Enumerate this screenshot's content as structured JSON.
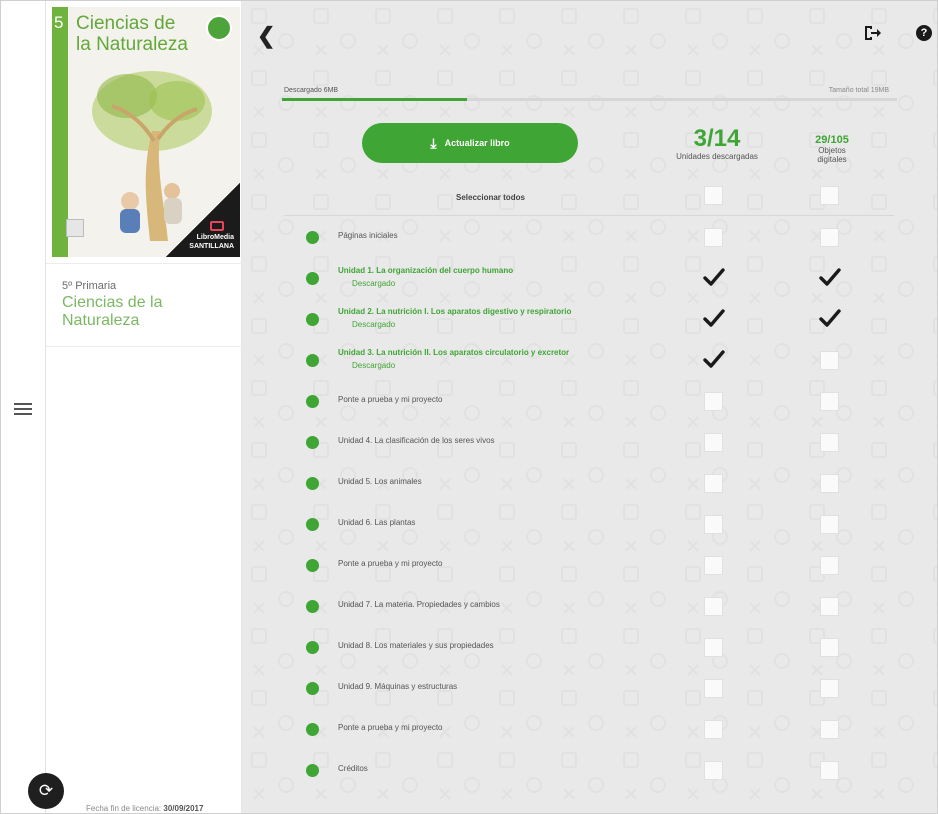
{
  "app": {
    "back_icon": "chevron-left-icon",
    "logout_icon": "logout-icon",
    "help_icon": "help-icon",
    "help_glyph": "?",
    "menu_icon": "hamburger-icon",
    "sync_icon": "sync-icon"
  },
  "book": {
    "cover_grade": "5",
    "cover_title_line1": "Ciencias de",
    "cover_title_line2": "la Naturaleza",
    "publisher_line1": "LibroMedia",
    "publisher_line2": "SANTILLANA",
    "level": "5º Primaria",
    "name_line1": "Ciencias de la",
    "name_line2": "Naturaleza",
    "license_label": "Fecha fin de licencia:",
    "license_date": "30/09/2017"
  },
  "download": {
    "label": "Descargado 6MB",
    "total": "Tamaño total 19MB",
    "progress": 0.3
  },
  "update_button": {
    "label": "Actualizar libro",
    "icon": "download-icon"
  },
  "stats": {
    "units_value": "3/14",
    "units_label": "Unidades descargadas",
    "objects_value": "29/105",
    "objects_label_line1": "Objetos",
    "objects_label_line2": "digitales"
  },
  "select_all": {
    "label": "Seleccionar todos",
    "units_checked": false,
    "objects_checked": false
  },
  "status_downloaded": "Descargado",
  "units": [
    {
      "title": "Páginas iniciales",
      "downloaded": false,
      "units_checked": false,
      "objects_checked": false
    },
    {
      "title": "Unidad 1. La organización del cuerpo humano",
      "downloaded": true,
      "units_checked": true,
      "objects_checked": true
    },
    {
      "title": "Unidad 2. La nutrición I. Los aparatos digestivo y respiratorio",
      "downloaded": true,
      "units_checked": true,
      "objects_checked": true
    },
    {
      "title": "Unidad 3. La nutrición II. Los aparatos circulatorio y excretor",
      "downloaded": true,
      "units_checked": true,
      "objects_checked": false
    },
    {
      "title": "Ponte a prueba y mi proyecto",
      "downloaded": false,
      "units_checked": false,
      "objects_checked": false
    },
    {
      "title": "Unidad 4. La clasificación de los seres vivos",
      "downloaded": false,
      "units_checked": false,
      "objects_checked": false
    },
    {
      "title": "Unidad 5. Los animales",
      "downloaded": false,
      "units_checked": false,
      "objects_checked": false
    },
    {
      "title": "Unidad 6. Las plantas",
      "downloaded": false,
      "units_checked": false,
      "objects_checked": false
    },
    {
      "title": "Ponte a prueba y mi proyecto",
      "downloaded": false,
      "units_checked": false,
      "objects_checked": false
    },
    {
      "title": "Unidad 7. La materia. Propiedades y cambios",
      "downloaded": false,
      "units_checked": false,
      "objects_checked": false
    },
    {
      "title": "Unidad 8. Los materiales y sus propiedades",
      "downloaded": false,
      "units_checked": false,
      "objects_checked": false
    },
    {
      "title": "Unidad 9. Máquinas y estructuras",
      "downloaded": false,
      "units_checked": false,
      "objects_checked": false
    },
    {
      "title": "Ponte a prueba y mi proyecto",
      "downloaded": false,
      "units_checked": false,
      "objects_checked": false
    },
    {
      "title": "Créditos",
      "downloaded": false,
      "units_checked": false,
      "objects_checked": false
    }
  ],
  "colors": {
    "accent": "#3fa535",
    "book_title": "#7cb864"
  }
}
